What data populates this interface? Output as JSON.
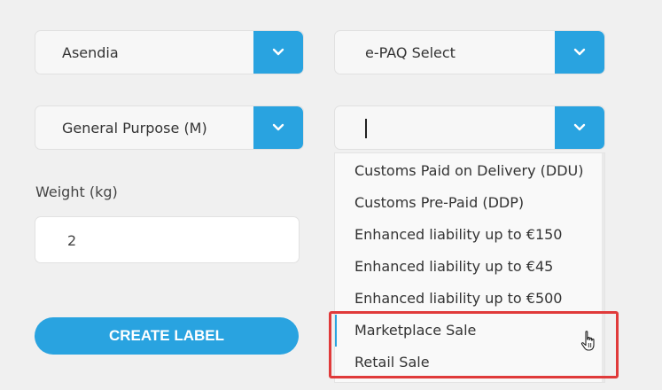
{
  "top_text": "",
  "carrier_select": {
    "value": "Asendia"
  },
  "service_select": {
    "value": "e-PAQ Select"
  },
  "category_select": {
    "value": "General Purpose (M)"
  },
  "terms_select": {
    "value": ""
  },
  "weight": {
    "label": "Weight (kg)",
    "value": "2"
  },
  "create_button": {
    "label": "CREATE LABEL"
  },
  "dropdown": {
    "options": [
      "Customs Paid on Delivery (DDU)",
      "Customs Pre-Paid (DDP)",
      "Enhanced liability up to €150",
      "Enhanced liability up to €45",
      "Enhanced liability up to €500",
      "Marketplace Sale",
      "Retail Sale"
    ],
    "hovered": "Marketplace Sale"
  },
  "colors": {
    "accent": "#29a3e0",
    "highlight": "#e03a3a",
    "background": "#f0f0f0"
  },
  "icons": [
    "chevron-down-icon",
    "hand-pointer-cursor-icon"
  ]
}
